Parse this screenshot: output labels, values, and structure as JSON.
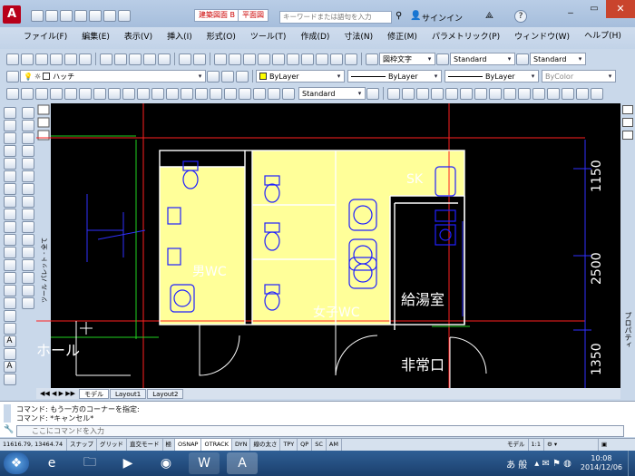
{
  "title_bar": {
    "workspace": "建築図面 B",
    "file_tab": "平面図",
    "search_placeholder": "キーワードまたは語句を入力",
    "signin": "サインイン",
    "help": "?"
  },
  "menu": [
    "ファイル(F)",
    "編集(E)",
    "表示(V)",
    "挿入(I)",
    "形式(O)",
    "ツール(T)",
    "作成(D)",
    "寸法(N)",
    "修正(M)",
    "パラメトリック(P)",
    "ウィンドウ(W)",
    "ヘルプ(H)"
  ],
  "toolbar1": {
    "text_style": "図枠文字",
    "dim_style": "Standard",
    "table_style": "Standard"
  },
  "toolbar2": {
    "layer": "ハッチ",
    "color": "ByLayer",
    "linetype": "ByLayer",
    "lineweight": "ByLayer",
    "plotstyle": "ByColor"
  },
  "toolbar3": {
    "dim_style": "Standard"
  },
  "palette": {
    "left_label": "ツール パレット - 全て",
    "right_label": "プロパティ"
  },
  "drawing": {
    "room_men": "男WC",
    "room_women": "女子WC",
    "room_kitchen": "給湯室",
    "room_exit": "非常口",
    "room_hall": "ホール",
    "sink": "SK",
    "dims": [
      "1150",
      "2500",
      "1350"
    ]
  },
  "layout_tabs": [
    "モデル",
    "Layout1",
    "Layout2"
  ],
  "command": {
    "line1": "コマンド: もう一方のコーナーを指定:",
    "line2": "コマンド: *キャンセル*",
    "input_placeholder": "ここにコマンドを入力"
  },
  "status": {
    "coords": "11616.79, 13464.74",
    "toggles": [
      "スナップ",
      "グリッド",
      "直交モード",
      "極",
      "OSNAP",
      "OTRACK",
      "DYN",
      "線の太さ",
      "TPY",
      "QP",
      "SC",
      "AM"
    ],
    "on": [
      "OSNAP",
      "OTRACK"
    ],
    "model": "モデル",
    "scale": "1:1"
  },
  "taskbar": {
    "ime": "あ 般",
    "time": "10:08",
    "date": "2014/12/06"
  },
  "colors": {
    "wc_fill": "#ffff99",
    "wall": "#ffffff",
    "grid_red": "#ff2020",
    "blue": "#2020ff",
    "green": "#20d020"
  }
}
